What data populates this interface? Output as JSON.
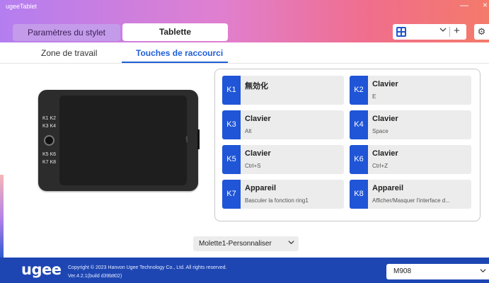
{
  "app": {
    "title": "ugeeTablet"
  },
  "window": {
    "minimize": "—",
    "close": "×"
  },
  "tabs": {
    "stylus": "Paramètres du stylet",
    "tablet": "Tablette"
  },
  "toolbar": {
    "plus": "+",
    "dropdown_icon": "chevron-down"
  },
  "subtabs": {
    "work_area": "Zone de travail",
    "shortcuts": "Touches de raccourci"
  },
  "device": {
    "labels": [
      "K1 K2",
      "K3 K4",
      "K5 K6",
      "K7 K8"
    ],
    "brand": "ugee"
  },
  "keys": [
    {
      "id": "K1",
      "title": "無効化",
      "sub": ""
    },
    {
      "id": "K2",
      "title": "Clavier",
      "sub": "E"
    },
    {
      "id": "K3",
      "title": "Clavier",
      "sub": "Alt"
    },
    {
      "id": "K4",
      "title": "Clavier",
      "sub": "Space"
    },
    {
      "id": "K5",
      "title": "Clavier",
      "sub": "Ctrl+S"
    },
    {
      "id": "K6",
      "title": "Clavier",
      "sub": "Ctrl+Z"
    },
    {
      "id": "K7",
      "title": "Appareil",
      "sub": "Basculer la fonction ring1"
    },
    {
      "id": "K8",
      "title": "Appareil",
      "sub": "Afficher/Masquer l'interface d..."
    }
  ],
  "dial": {
    "selected": "Molette1-Personnaliser"
  },
  "footer": {
    "logo": "ugee",
    "copyright": "Copyright © 2023 Hanvon Ugee Technology Co., Ltd. All rights reserved.",
    "version": "Ver.4.2.1(build d39b802)",
    "model": "M908"
  },
  "colors": {
    "accent": "#1f55d6",
    "header_start": "#b47ef0",
    "header_end": "#f47a6a",
    "footer": "#1d46b3"
  }
}
